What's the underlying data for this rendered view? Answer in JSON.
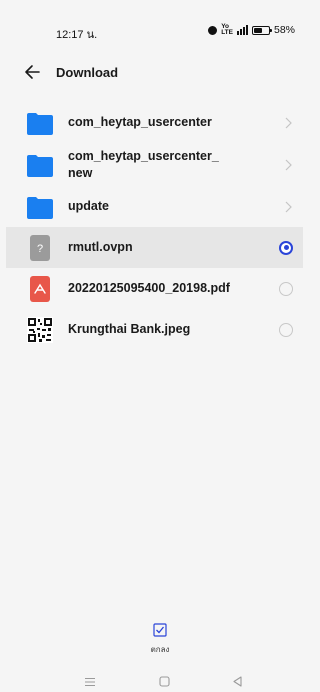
{
  "status_bar": {
    "time": "12:17 น.",
    "battery": "58%",
    "battery_level": 0.58,
    "volte": [
      "Yo",
      "LTE"
    ]
  },
  "header": {
    "title": "Download"
  },
  "files": [
    {
      "name": "com_heytap_usercenter",
      "type": "folder",
      "icon": "folder-icon"
    },
    {
      "name": "com_heytap_usercenter_new",
      "type": "folder",
      "icon": "folder-icon"
    },
    {
      "name": "update",
      "type": "folder",
      "icon": "folder-icon"
    },
    {
      "name": "rmutl.ovpn",
      "type": "file",
      "icon": "unknown-file-icon",
      "selected": true
    },
    {
      "name": "20220125095400_20198.pdf",
      "type": "file",
      "icon": "pdf-file-icon",
      "selected": false
    },
    {
      "name": "Krungthai Bank.jpeg",
      "type": "file",
      "icon": "qr-image-thumbnail",
      "selected": false
    }
  ],
  "bottom_bar": {
    "ok_label": "ตกลง"
  },
  "colors": {
    "accent": "#2a44d8",
    "folder": "#1a7ff0",
    "pdf": "#e8574a"
  }
}
